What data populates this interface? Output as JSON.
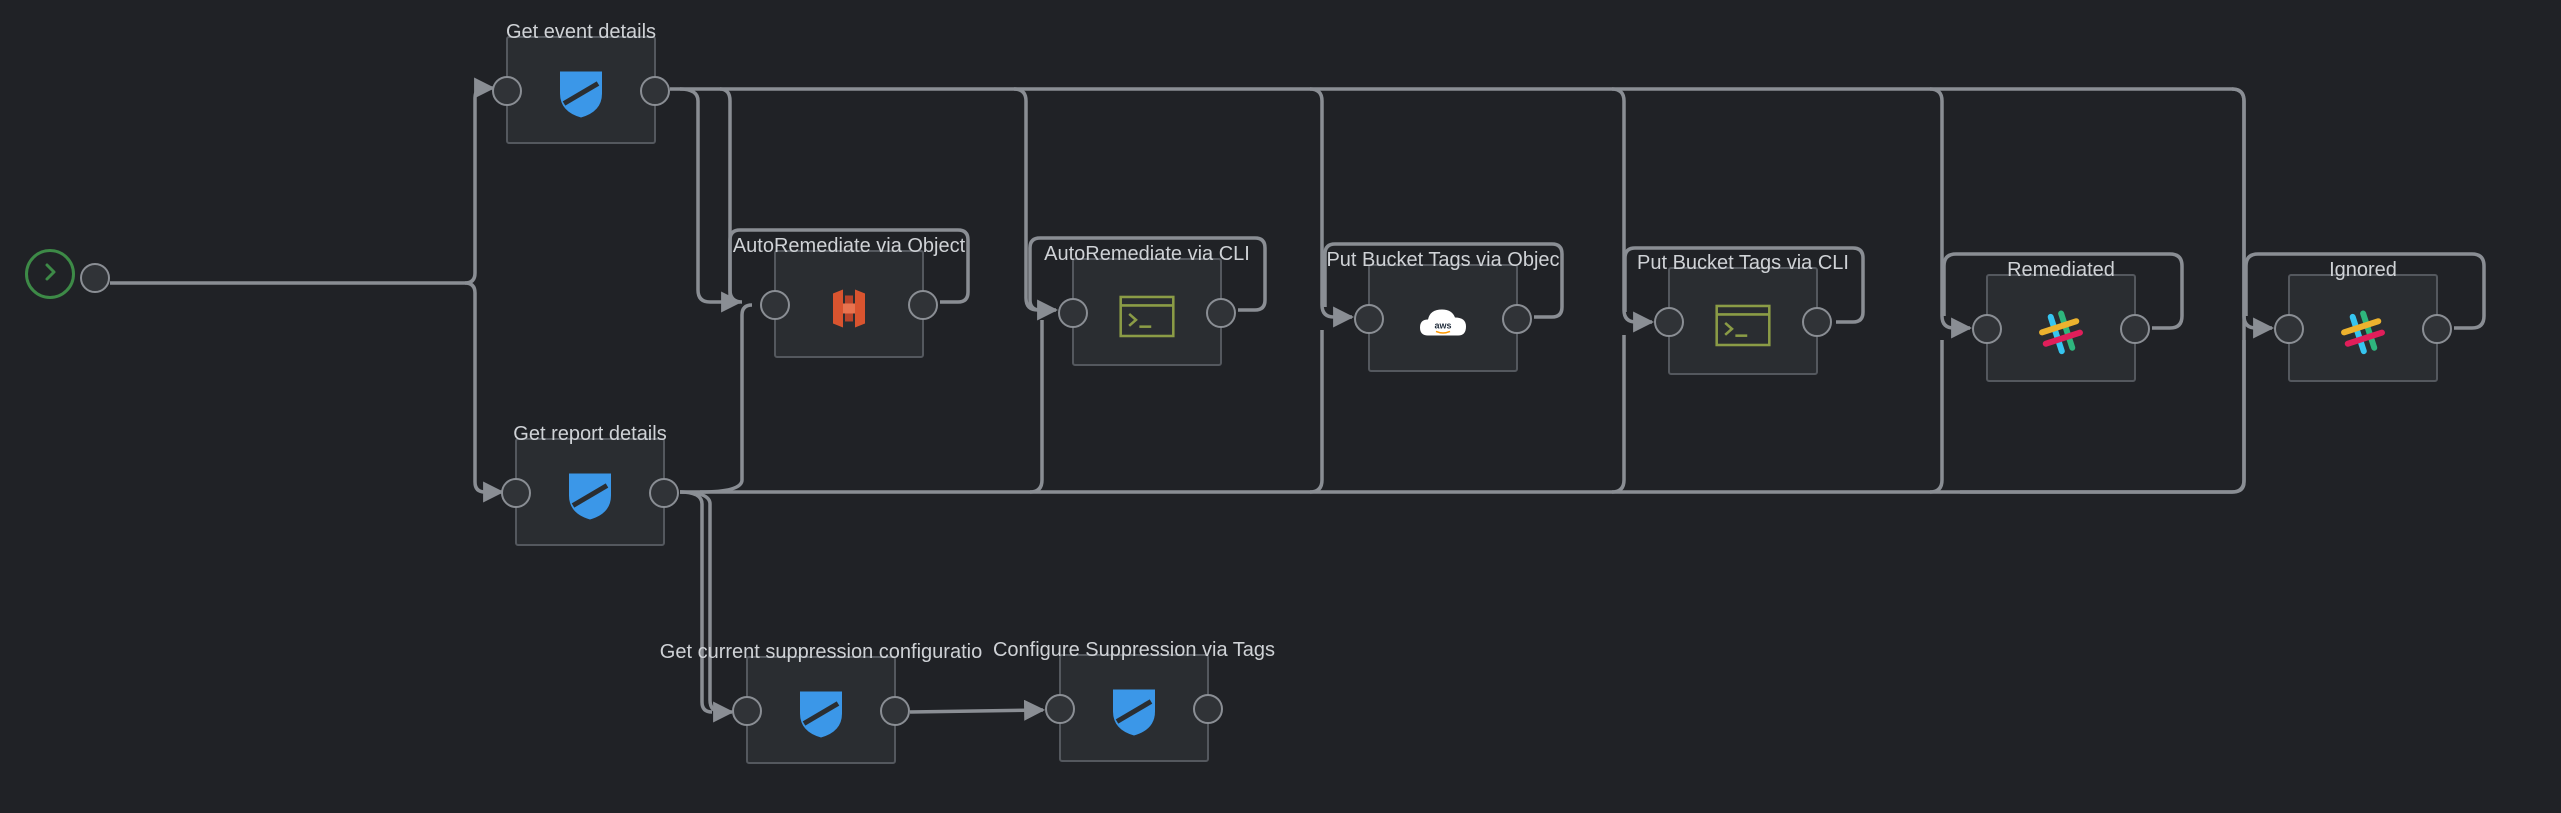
{
  "colors": {
    "background": "#202226",
    "edge": "#8a8e94",
    "start_accent": "#3d8a47",
    "shield_blue": "#3b97e8",
    "aws_orange": "#d9542f",
    "terminal_green": "#8b9c46"
  },
  "start": {
    "icon": "chevron-right-icon"
  },
  "nodes": [
    {
      "id": "get-event",
      "label": "Get event details",
      "icon": "shield-icon"
    },
    {
      "id": "get-report",
      "label": "Get report details",
      "icon": "shield-icon"
    },
    {
      "id": "auto-obj",
      "label": "AutoRemediate via Object",
      "icon": "aws-s3-icon"
    },
    {
      "id": "auto-cli",
      "label": "AutoRemediate via CLI",
      "icon": "terminal-icon"
    },
    {
      "id": "tags-obj",
      "label": "Put Bucket Tags via Objec",
      "icon": "aws-cloud-icon"
    },
    {
      "id": "tags-cli",
      "label": "Put Bucket Tags via CLI",
      "icon": "terminal-icon"
    },
    {
      "id": "remediated",
      "label": "Remediated",
      "icon": "slack-icon"
    },
    {
      "id": "ignored",
      "label": "Ignored",
      "icon": "slack-icon"
    },
    {
      "id": "get-suppression",
      "label": "Get current suppression configuratio",
      "icon": "shield-icon"
    },
    {
      "id": "configure-suppression",
      "label": "Configure Suppression via Tags",
      "icon": "shield-icon"
    }
  ],
  "aws_cloud_text": "aws"
}
